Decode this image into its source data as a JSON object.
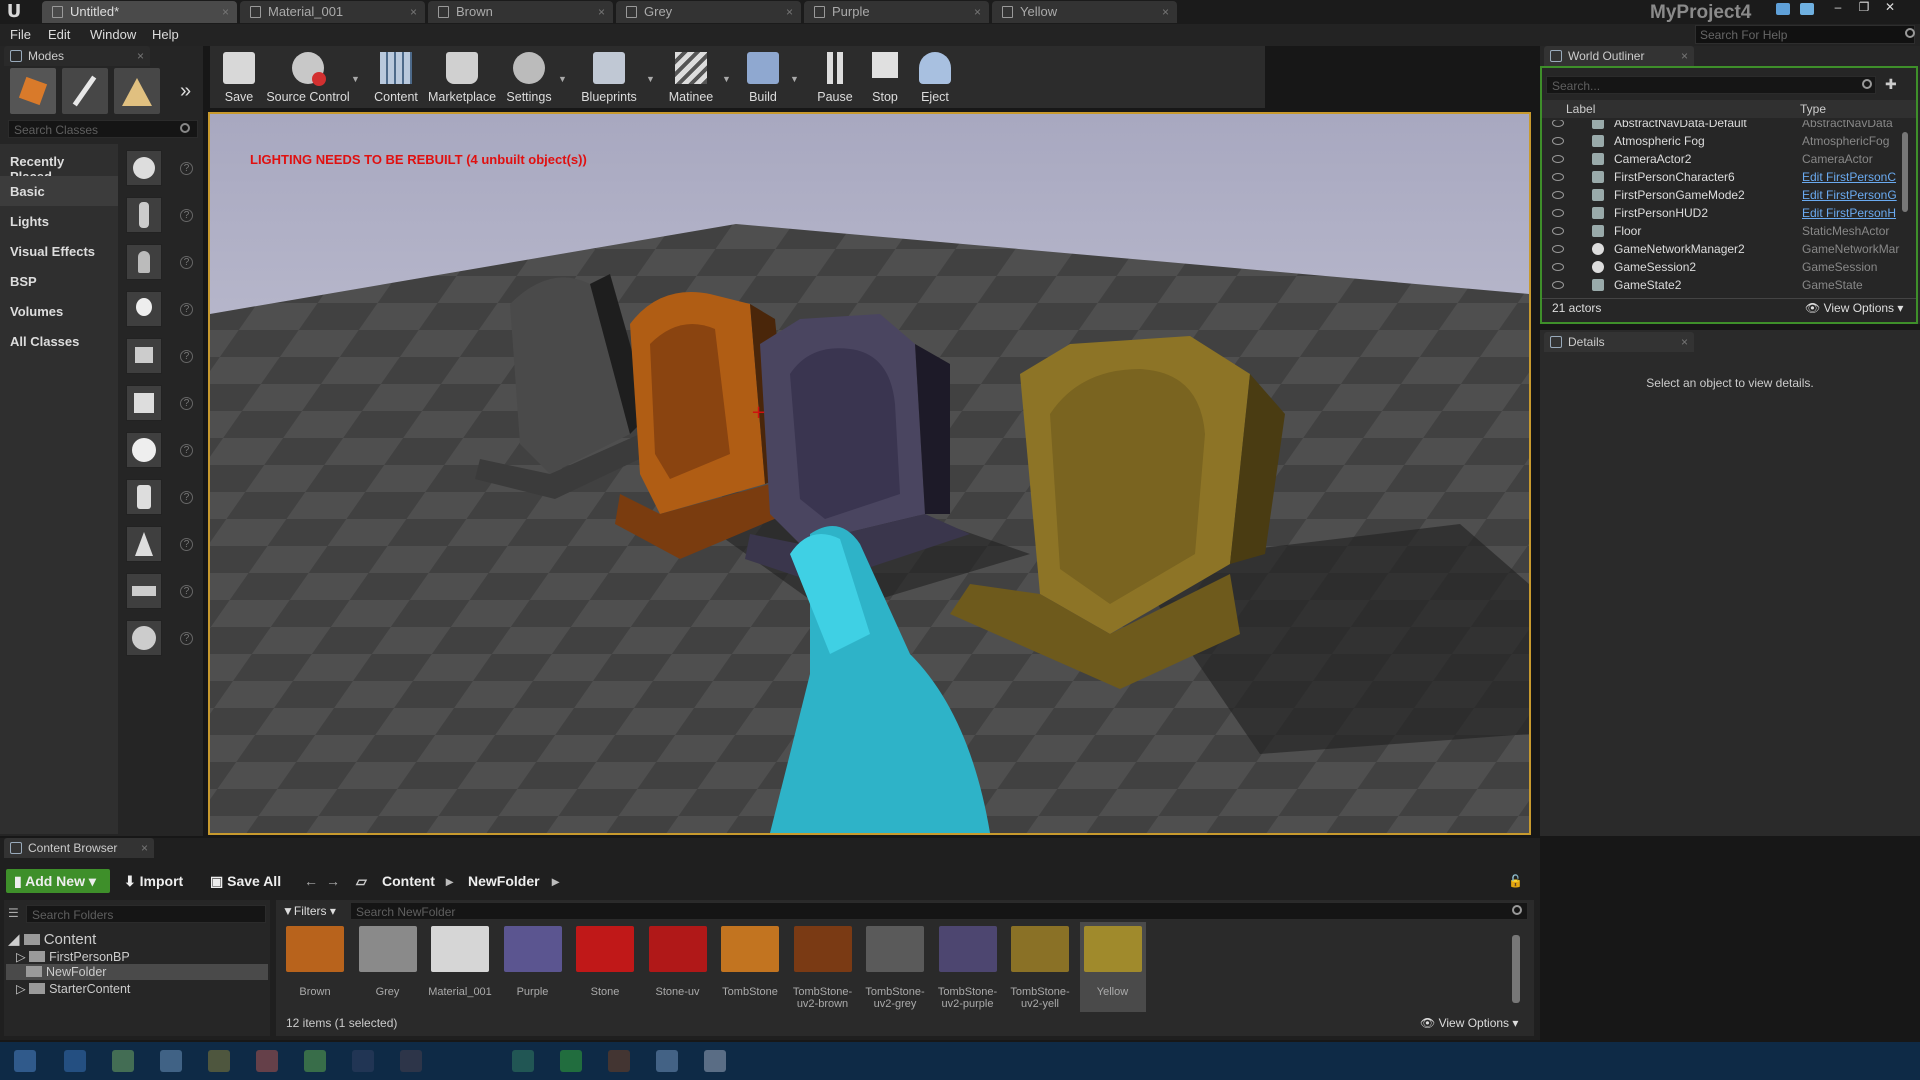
{
  "window": {
    "project": "MyProject4",
    "help_search_placeholder": "Search For Help"
  },
  "tabs": [
    "Untitled*",
    "Material_001",
    "Brown",
    "Grey",
    "Purple",
    "Yellow"
  ],
  "menu": [
    "File",
    "Edit",
    "Window",
    "Help"
  ],
  "modes": {
    "tab_label": "Modes",
    "search_placeholder": "Search Classes",
    "categories": [
      "Recently Placed",
      "Basic",
      "Lights",
      "Visual Effects",
      "BSP",
      "Volumes",
      "All Classes"
    ],
    "selected_category": "Basic",
    "expand_glyph": "»"
  },
  "toolbar": {
    "buttons": [
      "Save",
      "Source Control",
      "Content",
      "Marketplace",
      "Settings",
      "Blueprints",
      "Matinee",
      "Build",
      "Pause",
      "Stop",
      "Eject"
    ]
  },
  "viewport": {
    "warning": "LIGHTING NEEDS TO BE REBUILT (4 unbuilt object(s))",
    "crosshair": "+"
  },
  "outliner": {
    "tab_label": "World Outliner",
    "search_placeholder": "Search...",
    "col_label": "Label",
    "col_type": "Type",
    "rows": [
      {
        "label": "AbstractNavData-Default",
        "type": "AbstractNavData"
      },
      {
        "label": "Atmospheric Fog",
        "type": "AtmosphericFog"
      },
      {
        "label": "CameraActor2",
        "type": "CameraActor"
      },
      {
        "label": "FirstPersonCharacter6",
        "type": "Edit FirstPersonC"
      },
      {
        "label": "FirstPersonGameMode2",
        "type": "Edit FirstPersonG"
      },
      {
        "label": "FirstPersonHUD2",
        "type": "Edit FirstPersonH"
      },
      {
        "label": "Floor",
        "type": "StaticMeshActor"
      },
      {
        "label": "GameNetworkManager2",
        "type": "GameNetworkMar"
      },
      {
        "label": "GameSession2",
        "type": "GameSession"
      },
      {
        "label": "GameState2",
        "type": "GameState"
      }
    ],
    "count": "21 actors",
    "view_options": "View Options"
  },
  "details": {
    "tab_label": "Details",
    "empty_message": "Select an object to view details."
  },
  "content_browser": {
    "tab_label": "Content Browser",
    "add_new": "Add New",
    "import": "Import",
    "save_all": "Save All",
    "path": [
      "Content",
      "NewFolder"
    ],
    "folder_search_placeholder": "Search Folders",
    "filters": "Filters",
    "asset_search_placeholder": "Search NewFolder",
    "tree": {
      "root": "Content",
      "children": [
        "FirstPersonBP",
        "NewFolder",
        "StarterContent"
      ],
      "selected": "NewFolder"
    },
    "assets": [
      {
        "name": "Brown",
        "color": "#b8631c"
      },
      {
        "name": "Grey",
        "color": "#8a8a8a"
      },
      {
        "name": "Material_001",
        "color": "#d6d6d6"
      },
      {
        "name": "Purple",
        "color": "#5b5590"
      },
      {
        "name": "Stone",
        "color": "#c01818"
      },
      {
        "name": "Stone-uv",
        "color": "#b01818"
      },
      {
        "name": "TombStone",
        "color": "#c27420"
      },
      {
        "name": "TombStone-uv2-brown",
        "color": "#7a3a14"
      },
      {
        "name": "TombStone-uv2-grey",
        "color": "#5a5a5a"
      },
      {
        "name": "TombStone-uv2-purple",
        "color": "#4d4670"
      },
      {
        "name": "TombStone-uv2-yell",
        "color": "#8a7126"
      },
      {
        "name": "Yellow",
        "color": "#a08a2c"
      }
    ],
    "selected_asset": "Yellow",
    "status": "12 items (1 selected)",
    "view_options": "View Options"
  },
  "colors": {
    "accent": "#c89a2e",
    "add_new": "#3e8f2a",
    "warning": "#e01010",
    "link": "#6aaaf0"
  }
}
